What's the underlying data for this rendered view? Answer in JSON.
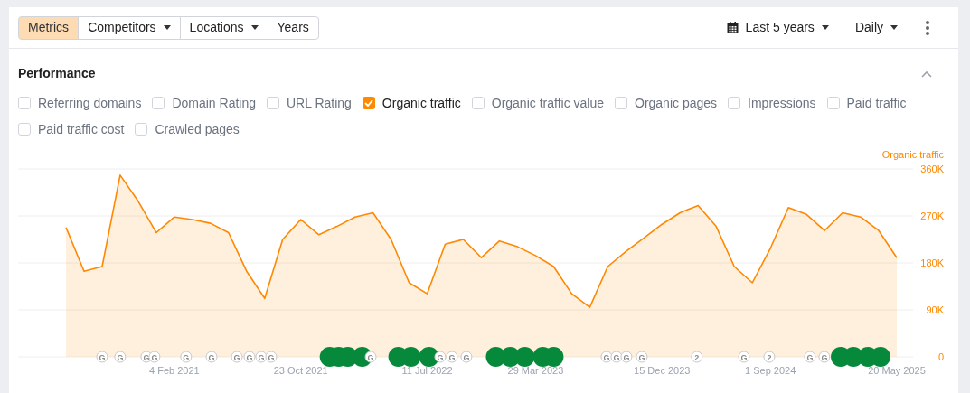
{
  "toolbar": {
    "segments": [
      {
        "label": "Metrics",
        "selected": true,
        "dropdown": false
      },
      {
        "label": "Competitors",
        "selected": false,
        "dropdown": true
      },
      {
        "label": "Locations",
        "selected": false,
        "dropdown": true
      },
      {
        "label": "Years",
        "selected": false,
        "dropdown": false
      }
    ],
    "range": "Last 5 years",
    "interval": "Daily"
  },
  "performance": {
    "title": "Performance",
    "expanded": true,
    "metrics": [
      {
        "label": "Referring domains",
        "checked": false
      },
      {
        "label": "Domain Rating",
        "checked": false
      },
      {
        "label": "URL Rating",
        "checked": false
      },
      {
        "label": "Organic traffic",
        "checked": true
      },
      {
        "label": "Organic traffic value",
        "checked": false
      },
      {
        "label": "Organic pages",
        "checked": false
      },
      {
        "label": "Impressions",
        "checked": false
      },
      {
        "label": "Paid traffic",
        "checked": false
      },
      {
        "label": "Paid traffic cost",
        "checked": false
      },
      {
        "label": "Crawled pages",
        "checked": false
      }
    ],
    "chart_data": {
      "type": "area",
      "grid": true,
      "ylim": [
        0,
        360000
      ],
      "yticks": [
        {
          "value": 0,
          "label": "0"
        },
        {
          "value": 90000,
          "label": "90K"
        },
        {
          "value": 180000,
          "label": "180K"
        },
        {
          "value": 270000,
          "label": "270K"
        },
        {
          "value": 360000,
          "label": "360K"
        }
      ],
      "categories": [
        null,
        null,
        null,
        null,
        null,
        null,
        "4 Feb 2021",
        null,
        null,
        null,
        null,
        null,
        null,
        "23 Oct 2021",
        null,
        null,
        null,
        null,
        null,
        null,
        "11 Jul 2022",
        null,
        null,
        null,
        null,
        null,
        "29 Mar 2023",
        null,
        null,
        null,
        null,
        null,
        null,
        "15 Dec 2023",
        null,
        null,
        null,
        null,
        null,
        "1 Sep 2024",
        null,
        null,
        null,
        null,
        null,
        null,
        "20 May 2025"
      ],
      "series": [
        {
          "name": "Organic traffic",
          "color": "#ff8800",
          "values": [
            248000,
            164000,
            173000,
            348000,
            298000,
            238000,
            268000,
            263000,
            256000,
            238000,
            164000,
            112000,
            225000,
            263000,
            234000,
            250000,
            268000,
            276000,
            225000,
            142000,
            121000,
            216000,
            225000,
            190000,
            222000,
            211000,
            194000,
            173000,
            121000,
            95000,
            173000,
            202000,
            228000,
            254000,
            276000,
            290000,
            250000,
            173000,
            142000,
            208000,
            286000,
            273000,
            242000,
            276000,
            268000,
            242000,
            190000
          ]
        }
      ],
      "annotations": [
        "G",
        "G",
        "G",
        "G",
        "G",
        "G",
        "G",
        "G",
        "G",
        "G",
        "G",
        "G",
        "G",
        "G",
        "G",
        "G",
        "G",
        "G",
        "2",
        "G",
        "2",
        "G",
        "G"
      ]
    }
  }
}
